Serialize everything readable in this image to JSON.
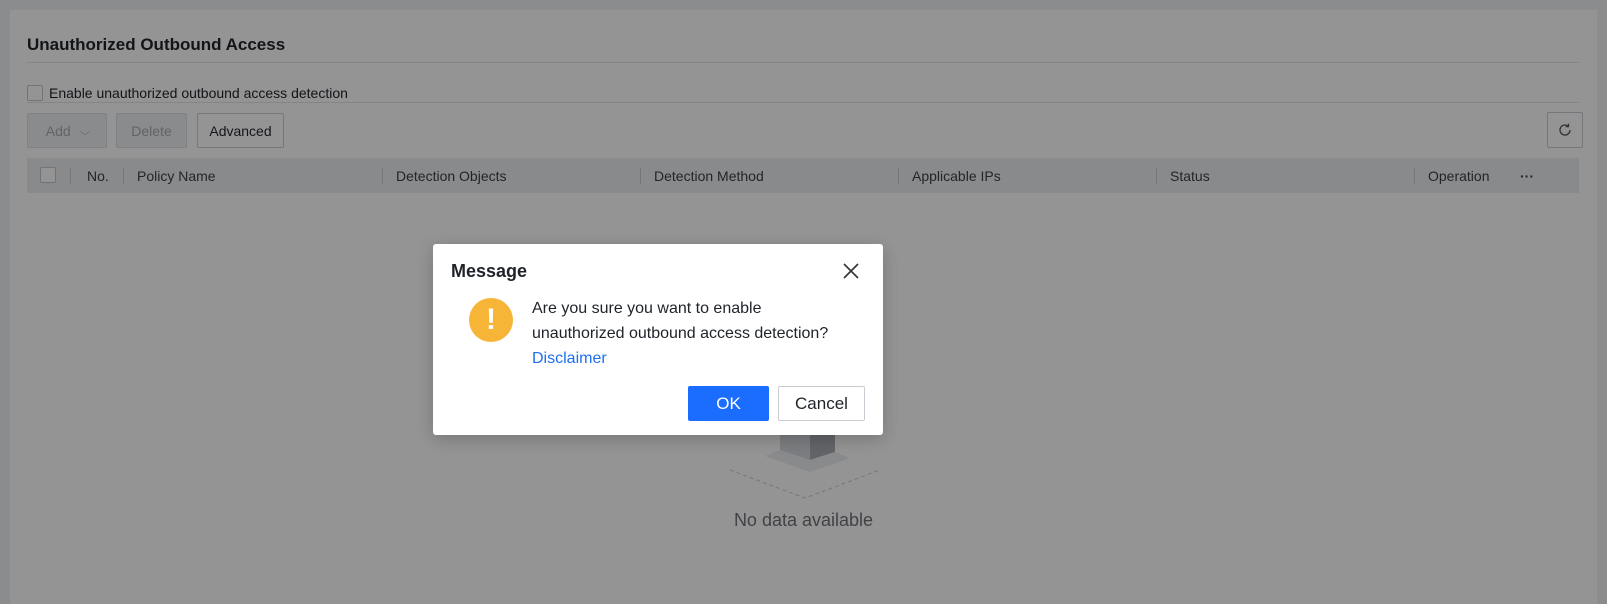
{
  "page": {
    "title": "Unauthorized Outbound Access",
    "enable_label": "Enable unauthorized outbound access detection"
  },
  "toolbar": {
    "add_label": "Add",
    "add_chevron": "⌵",
    "delete_label": "Delete",
    "advanced_label": "Advanced"
  },
  "table": {
    "columns": [
      "No.",
      "Policy Name",
      "Detection Objects",
      "Detection Method",
      "Applicable IPs",
      "Status",
      "Operation"
    ],
    "more_label": "···",
    "empty_text": "No data available"
  },
  "dialog": {
    "title": "Message",
    "warning_glyph": "!",
    "message": "Are you sure you want to enable unauthorized outbound access detection?",
    "link": "Disclaimer",
    "ok_label": "OK",
    "cancel_label": "Cancel"
  },
  "colors": {
    "primary": "#1a6dff",
    "warning": "#f7b538",
    "link": "#1d6ff2"
  }
}
